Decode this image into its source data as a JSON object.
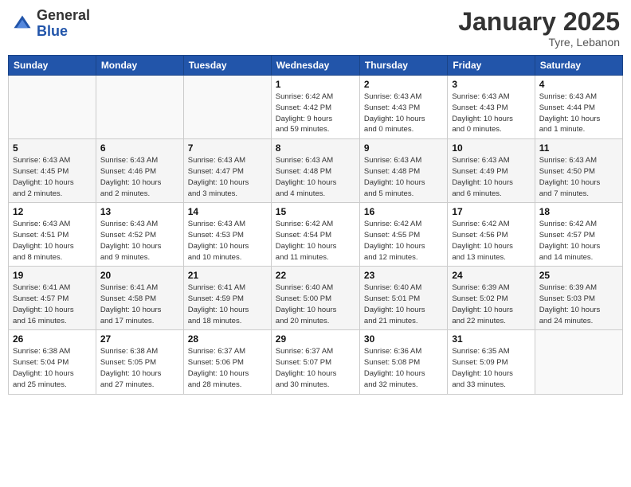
{
  "header": {
    "logo_general": "General",
    "logo_blue": "Blue",
    "month_title": "January 2025",
    "location": "Tyre, Lebanon"
  },
  "weekdays": [
    "Sunday",
    "Monday",
    "Tuesday",
    "Wednesday",
    "Thursday",
    "Friday",
    "Saturday"
  ],
  "weeks": [
    [
      {
        "day": "",
        "info": ""
      },
      {
        "day": "",
        "info": ""
      },
      {
        "day": "",
        "info": ""
      },
      {
        "day": "1",
        "info": "Sunrise: 6:42 AM\nSunset: 4:42 PM\nDaylight: 9 hours\nand 59 minutes."
      },
      {
        "day": "2",
        "info": "Sunrise: 6:43 AM\nSunset: 4:43 PM\nDaylight: 10 hours\nand 0 minutes."
      },
      {
        "day": "3",
        "info": "Sunrise: 6:43 AM\nSunset: 4:43 PM\nDaylight: 10 hours\nand 0 minutes."
      },
      {
        "day": "4",
        "info": "Sunrise: 6:43 AM\nSunset: 4:44 PM\nDaylight: 10 hours\nand 1 minute."
      }
    ],
    [
      {
        "day": "5",
        "info": "Sunrise: 6:43 AM\nSunset: 4:45 PM\nDaylight: 10 hours\nand 2 minutes."
      },
      {
        "day": "6",
        "info": "Sunrise: 6:43 AM\nSunset: 4:46 PM\nDaylight: 10 hours\nand 2 minutes."
      },
      {
        "day": "7",
        "info": "Sunrise: 6:43 AM\nSunset: 4:47 PM\nDaylight: 10 hours\nand 3 minutes."
      },
      {
        "day": "8",
        "info": "Sunrise: 6:43 AM\nSunset: 4:48 PM\nDaylight: 10 hours\nand 4 minutes."
      },
      {
        "day": "9",
        "info": "Sunrise: 6:43 AM\nSunset: 4:48 PM\nDaylight: 10 hours\nand 5 minutes."
      },
      {
        "day": "10",
        "info": "Sunrise: 6:43 AM\nSunset: 4:49 PM\nDaylight: 10 hours\nand 6 minutes."
      },
      {
        "day": "11",
        "info": "Sunrise: 6:43 AM\nSunset: 4:50 PM\nDaylight: 10 hours\nand 7 minutes."
      }
    ],
    [
      {
        "day": "12",
        "info": "Sunrise: 6:43 AM\nSunset: 4:51 PM\nDaylight: 10 hours\nand 8 minutes."
      },
      {
        "day": "13",
        "info": "Sunrise: 6:43 AM\nSunset: 4:52 PM\nDaylight: 10 hours\nand 9 minutes."
      },
      {
        "day": "14",
        "info": "Sunrise: 6:43 AM\nSunset: 4:53 PM\nDaylight: 10 hours\nand 10 minutes."
      },
      {
        "day": "15",
        "info": "Sunrise: 6:42 AM\nSunset: 4:54 PM\nDaylight: 10 hours\nand 11 minutes."
      },
      {
        "day": "16",
        "info": "Sunrise: 6:42 AM\nSunset: 4:55 PM\nDaylight: 10 hours\nand 12 minutes."
      },
      {
        "day": "17",
        "info": "Sunrise: 6:42 AM\nSunset: 4:56 PM\nDaylight: 10 hours\nand 13 minutes."
      },
      {
        "day": "18",
        "info": "Sunrise: 6:42 AM\nSunset: 4:57 PM\nDaylight: 10 hours\nand 14 minutes."
      }
    ],
    [
      {
        "day": "19",
        "info": "Sunrise: 6:41 AM\nSunset: 4:57 PM\nDaylight: 10 hours\nand 16 minutes."
      },
      {
        "day": "20",
        "info": "Sunrise: 6:41 AM\nSunset: 4:58 PM\nDaylight: 10 hours\nand 17 minutes."
      },
      {
        "day": "21",
        "info": "Sunrise: 6:41 AM\nSunset: 4:59 PM\nDaylight: 10 hours\nand 18 minutes."
      },
      {
        "day": "22",
        "info": "Sunrise: 6:40 AM\nSunset: 5:00 PM\nDaylight: 10 hours\nand 20 minutes."
      },
      {
        "day": "23",
        "info": "Sunrise: 6:40 AM\nSunset: 5:01 PM\nDaylight: 10 hours\nand 21 minutes."
      },
      {
        "day": "24",
        "info": "Sunrise: 6:39 AM\nSunset: 5:02 PM\nDaylight: 10 hours\nand 22 minutes."
      },
      {
        "day": "25",
        "info": "Sunrise: 6:39 AM\nSunset: 5:03 PM\nDaylight: 10 hours\nand 24 minutes."
      }
    ],
    [
      {
        "day": "26",
        "info": "Sunrise: 6:38 AM\nSunset: 5:04 PM\nDaylight: 10 hours\nand 25 minutes."
      },
      {
        "day": "27",
        "info": "Sunrise: 6:38 AM\nSunset: 5:05 PM\nDaylight: 10 hours\nand 27 minutes."
      },
      {
        "day": "28",
        "info": "Sunrise: 6:37 AM\nSunset: 5:06 PM\nDaylight: 10 hours\nand 28 minutes."
      },
      {
        "day": "29",
        "info": "Sunrise: 6:37 AM\nSunset: 5:07 PM\nDaylight: 10 hours\nand 30 minutes."
      },
      {
        "day": "30",
        "info": "Sunrise: 6:36 AM\nSunset: 5:08 PM\nDaylight: 10 hours\nand 32 minutes."
      },
      {
        "day": "31",
        "info": "Sunrise: 6:35 AM\nSunset: 5:09 PM\nDaylight: 10 hours\nand 33 minutes."
      },
      {
        "day": "",
        "info": ""
      }
    ]
  ]
}
